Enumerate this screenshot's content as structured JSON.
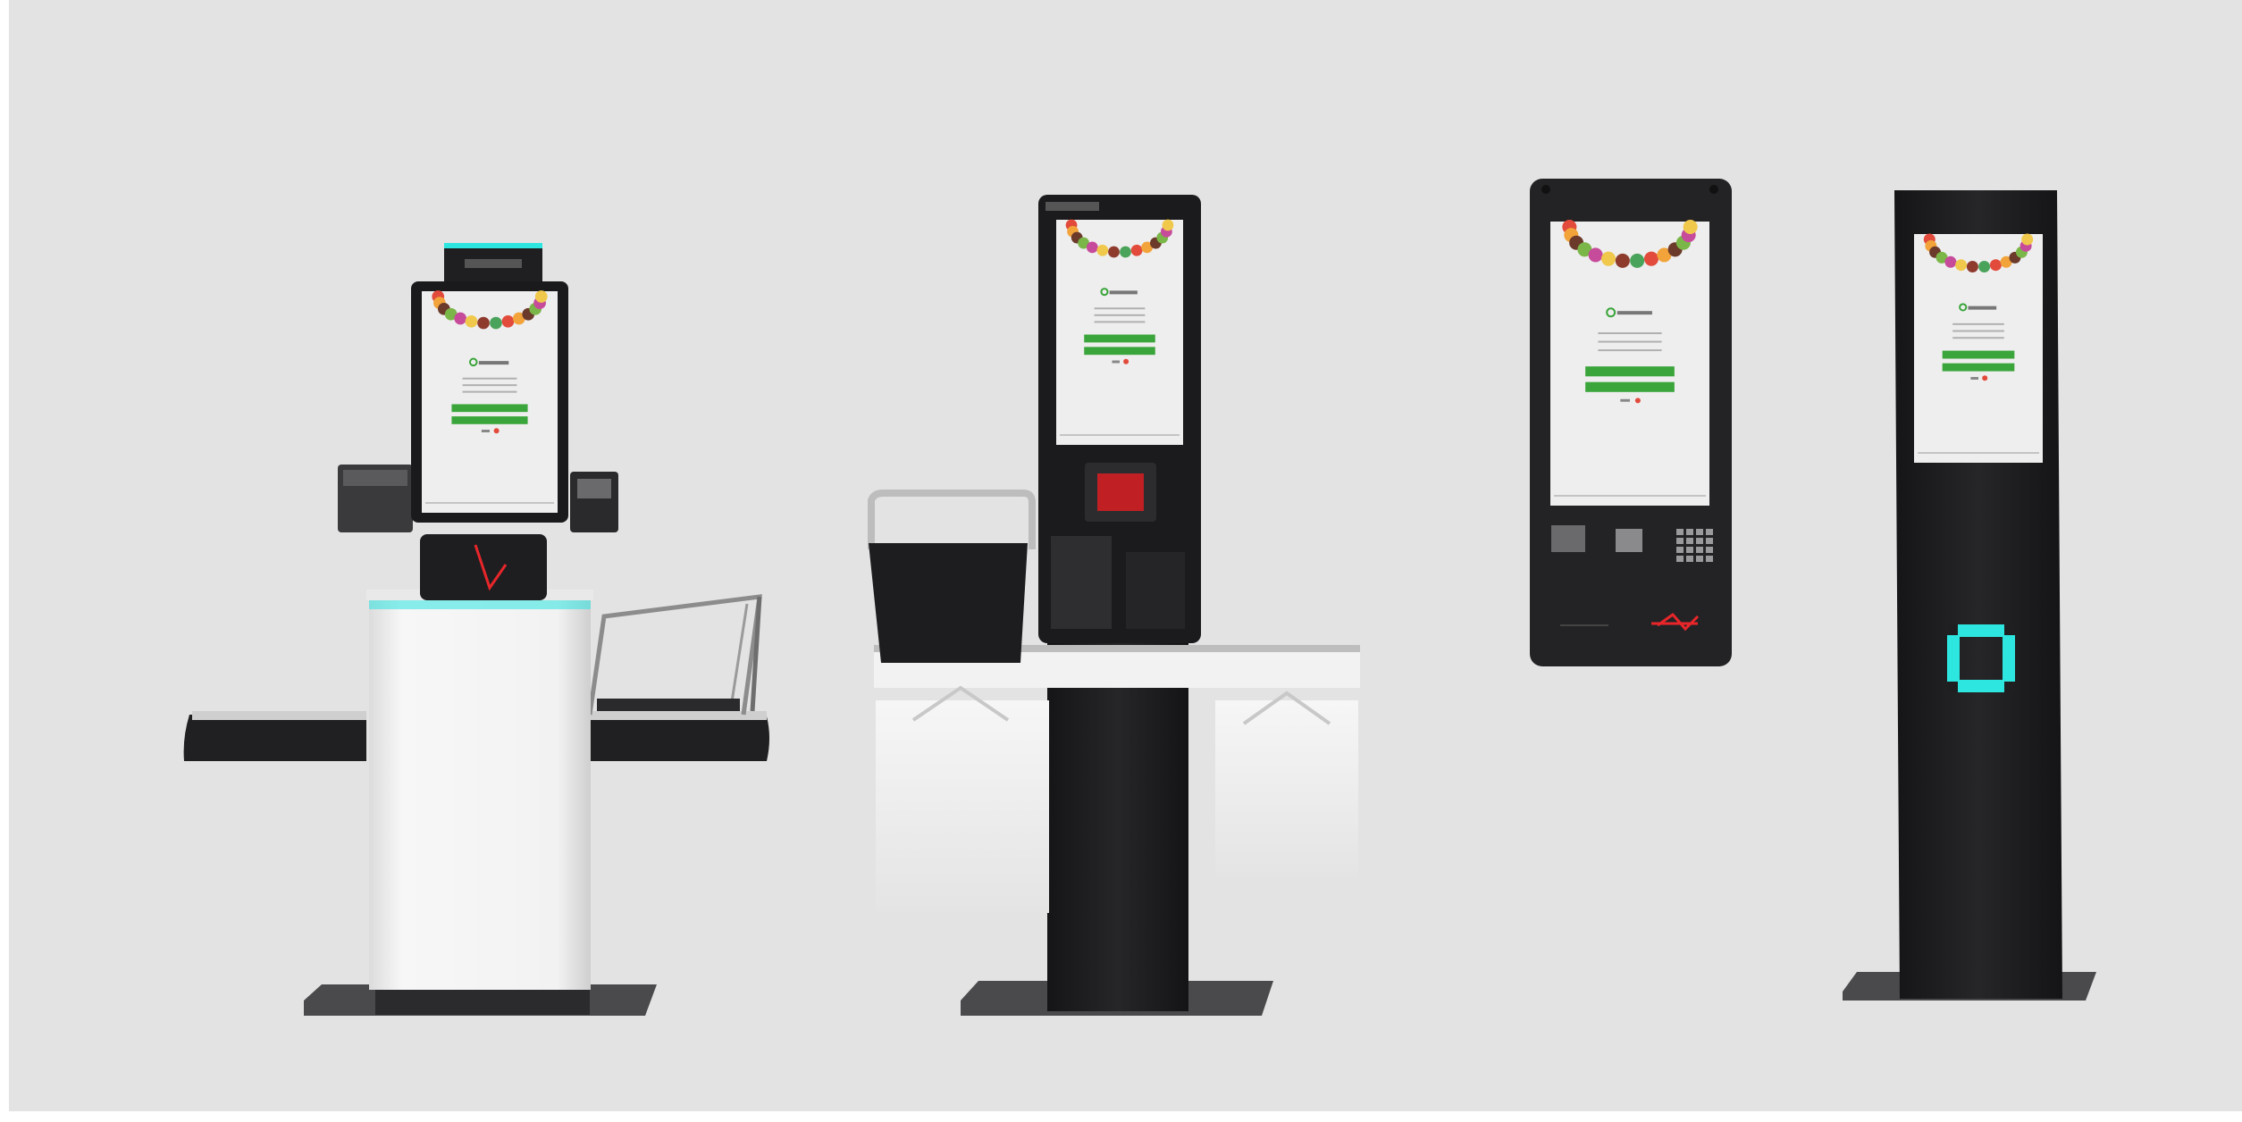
{
  "image": {
    "subject": "",
    "background_color": "#e3e3e3",
    "frame_color": "#ffffff"
  },
  "colors": {
    "body_black": "#1f1f21",
    "body_white": "#f1f1f1",
    "accent_cyan": "#2ee6e0",
    "screen_bg": "#eeeeee",
    "button_green": "#3aa53a",
    "scanner_red": "#e8262a",
    "metal": "#c9c9c9"
  },
  "kiosks": [
    {
      "name": "self-checkout-with-bagging-shelves",
      "icon": "checkout-kiosk-icon"
    },
    {
      "name": "checkout-with-basket-and-bag-holders",
      "icon": "checkout-kiosk-icon"
    },
    {
      "name": "wall-mounted-kiosk",
      "icon": "wall-kiosk-icon"
    },
    {
      "name": "floor-standing-totem",
      "icon": "totem-kiosk-icon"
    }
  ]
}
